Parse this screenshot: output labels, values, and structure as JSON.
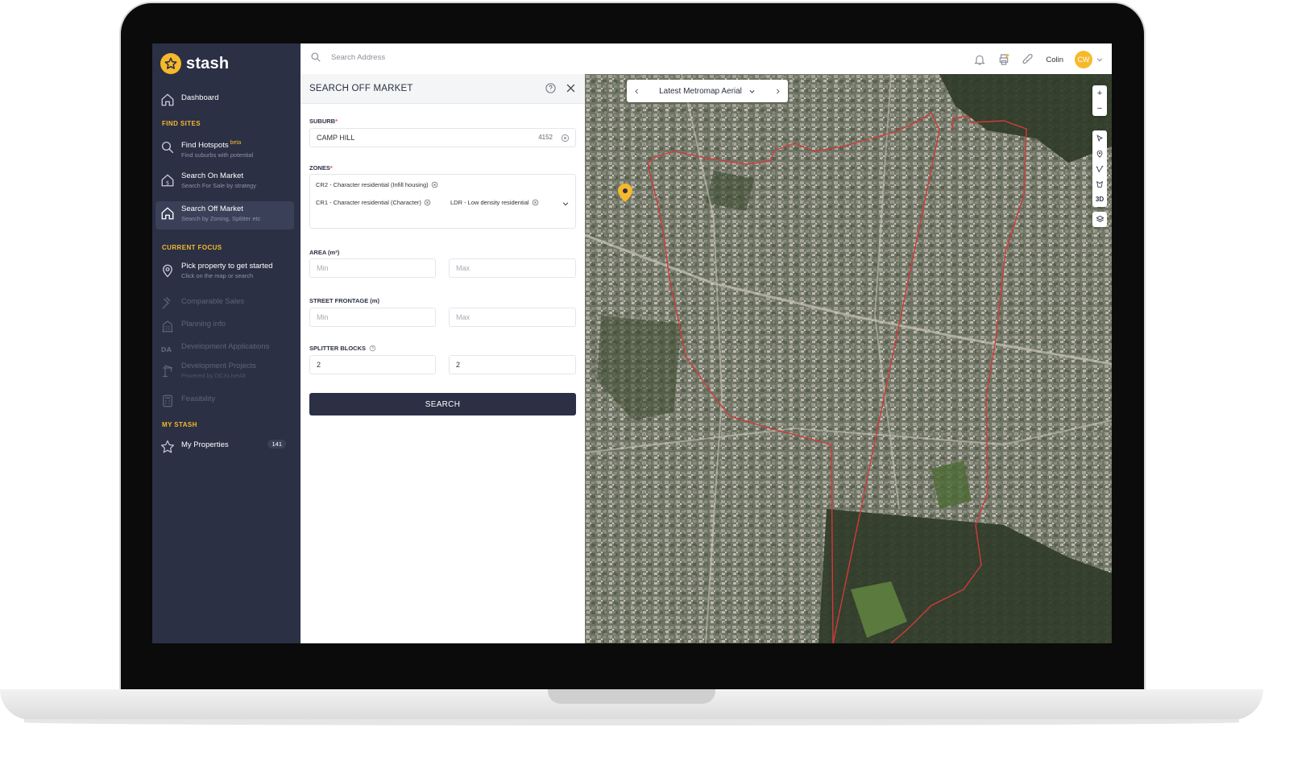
{
  "brand": {
    "name": "stash"
  },
  "sidebar": {
    "dashboard": "Dashboard",
    "sections": {
      "find_sites": "FIND SITES",
      "current_focus": "CURRENT FOCUS",
      "my_stash": "MY STASH"
    },
    "find_sites": [
      {
        "title": "Find Hotspots",
        "badge": "beta",
        "sub": "Find suburbs with potential"
      },
      {
        "title": "Search On Market",
        "sub": "Search For Sale by strategy"
      },
      {
        "title": "Search Off Market",
        "sub": "Search by Zoning, Splitter etc"
      }
    ],
    "current_focus": [
      {
        "title": "Pick property to get started",
        "sub": "Click on the map or search"
      },
      {
        "title": "Comparable Sales"
      },
      {
        "title": "Planning info"
      },
      {
        "title": "Development Applications"
      },
      {
        "title": "Development Projects",
        "sub": "Powered by DCXLiveAlt"
      },
      {
        "title": "Feasibility"
      }
    ],
    "my_properties": {
      "title": "My Properties",
      "count": "141"
    }
  },
  "topbar": {
    "search_placeholder": "Search Address",
    "user": "Colin",
    "initials": "CW"
  },
  "panel": {
    "title": "SEARCH OFF MARKET",
    "suburb_label": "SUBURB",
    "suburb_value": "CAMP HILL",
    "postcode": "4152",
    "zones_label": "ZONES",
    "zones": [
      "CR2 - Character residential (Infill housing)",
      "CR1 - Character residential (Character)",
      "LDR - Low density residential"
    ],
    "area_label": "AREA (m²)",
    "frontage_label": "STREET FRONTAGE (m)",
    "splitter_label": "SPLITTER BLOCKS",
    "min_placeholder": "Min",
    "max_placeholder": "Max",
    "splitter_min": "2",
    "splitter_max": "2",
    "search_button": "SEARCH"
  },
  "map": {
    "layer": "Latest Metromap Aerial",
    "zoom_in": "+",
    "zoom_out": "−",
    "three_d": "3D"
  },
  "colors": {
    "sidebar": "#2b3045",
    "accent": "#f6b92b",
    "boundary": "#d23a3a"
  }
}
